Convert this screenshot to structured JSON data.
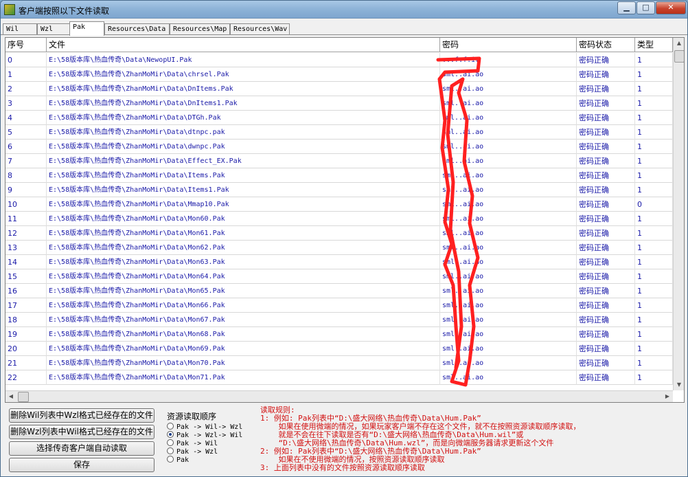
{
  "window": {
    "title": "客户端按照以下文件读取",
    "buttons": {
      "minimize": "▁",
      "maximize": "□",
      "close": "✕"
    }
  },
  "tabs": [
    {
      "label": "Wil",
      "active": false
    },
    {
      "label": "Wzl",
      "active": false
    },
    {
      "label": "Pak",
      "active": true
    },
    {
      "label": "Resources\\Data",
      "active": false
    },
    {
      "label": "Resources\\Map",
      "active": false
    },
    {
      "label": "Resources\\Wav",
      "active": false
    }
  ],
  "table": {
    "columns": [
      "序号",
      "文件",
      "密码",
      "密码状态",
      "类型"
    ],
    "rows": [
      {
        "idx": "0",
        "file": "E:\\58版本库\\热血传奇\\Data\\NewopUI.Pak",
        "pw": "...f.f.iv",
        "status": "密码正确",
        "type": "1"
      },
      {
        "idx": "1",
        "file": "E:\\58版本库\\热血传奇\\ZhanMoMir\\Data\\chrsel.Pak",
        "pw": "sml..ai.ao",
        "status": "密码正确",
        "type": "1"
      },
      {
        "idx": "2",
        "file": "E:\\58版本库\\热血传奇\\ZhanMoMir\\Data\\DnItems.Pak",
        "pw": "sml..ai.ao",
        "status": "密码正确",
        "type": "1"
      },
      {
        "idx": "3",
        "file": "E:\\58版本库\\热血传奇\\ZhanMoMir\\Data\\DnItems1.Pak",
        "pw": "sml..ai.ao",
        "status": "密码正确",
        "type": "1"
      },
      {
        "idx": "4",
        "file": "E:\\58版本库\\热血传奇\\ZhanMoMir\\Data\\DTGh.Pak",
        "pw": "sml..ai.ao",
        "status": "密码正确",
        "type": "1"
      },
      {
        "idx": "5",
        "file": "E:\\58版本库\\热血传奇\\ZhanMoMir\\Data\\dtnpc.pak",
        "pw": "sml..ai.ao",
        "status": "密码正确",
        "type": "1"
      },
      {
        "idx": "6",
        "file": "E:\\58版本库\\热血传奇\\ZhanMoMir\\Data\\dwnpc.Pak",
        "pw": "sml..ai.ao",
        "status": "密码正确",
        "type": "1"
      },
      {
        "idx": "7",
        "file": "E:\\58版本库\\热血传奇\\ZhanMoMir\\Data\\Effect_EX.Pak",
        "pw": "sml..ai.ao",
        "status": "密码正确",
        "type": "1"
      },
      {
        "idx": "8",
        "file": "E:\\58版本库\\热血传奇\\ZhanMoMir\\Data\\Items.Pak",
        "pw": "sml..ai.ao",
        "status": "密码正确",
        "type": "1"
      },
      {
        "idx": "9",
        "file": "E:\\58版本库\\热血传奇\\ZhanMoMir\\Data\\Items1.Pak",
        "pw": "sml..ai.ao",
        "status": "密码正确",
        "type": "1"
      },
      {
        "idx": "10",
        "file": "E:\\58版本库\\热血传奇\\ZhanMoMir\\Data\\Mmap10.Pak",
        "pw": "sml..ai.ao",
        "status": "密码正确",
        "type": "0"
      },
      {
        "idx": "11",
        "file": "E:\\58版本库\\热血传奇\\ZhanMoMir\\Data\\Mon60.Pak",
        "pw": "sml..ai.ao",
        "status": "密码正确",
        "type": "1"
      },
      {
        "idx": "12",
        "file": "E:\\58版本库\\热血传奇\\ZhanMoMir\\Data\\Mon61.Pak",
        "pw": "sml..ai.ao",
        "status": "密码正确",
        "type": "1"
      },
      {
        "idx": "13",
        "file": "E:\\58版本库\\热血传奇\\ZhanMoMir\\Data\\Mon62.Pak",
        "pw": "sml..ai.ao",
        "status": "密码正确",
        "type": "1"
      },
      {
        "idx": "14",
        "file": "E:\\58版本库\\热血传奇\\ZhanMoMir\\Data\\Mon63.Pak",
        "pw": "sml..ai.ao",
        "status": "密码正确",
        "type": "1"
      },
      {
        "idx": "15",
        "file": "E:\\58版本库\\热血传奇\\ZhanMoMir\\Data\\Mon64.Pak",
        "pw": "sml..ai.ao",
        "status": "密码正确",
        "type": "1"
      },
      {
        "idx": "16",
        "file": "E:\\58版本库\\热血传奇\\ZhanMoMir\\Data\\Mon65.Pak",
        "pw": "sml..ai.ao",
        "status": "密码正确",
        "type": "1"
      },
      {
        "idx": "17",
        "file": "E:\\58版本库\\热血传奇\\ZhanMoMir\\Data\\Mon66.Pak",
        "pw": "sml..ai.ao",
        "status": "密码正确",
        "type": "1"
      },
      {
        "idx": "18",
        "file": "E:\\58版本库\\热血传奇\\ZhanMoMir\\Data\\Mon67.Pak",
        "pw": "sml..ai.ao",
        "status": "密码正确",
        "type": "1"
      },
      {
        "idx": "19",
        "file": "E:\\58版本库\\热血传奇\\ZhanMoMir\\Data\\Mon68.Pak",
        "pw": "sml..ai.ao",
        "status": "密码正确",
        "type": "1"
      },
      {
        "idx": "20",
        "file": "E:\\58版本库\\热血传奇\\ZhanMoMir\\Data\\Mon69.Pak",
        "pw": "sml..ai.ao",
        "status": "密码正确",
        "type": "1"
      },
      {
        "idx": "21",
        "file": "E:\\58版本库\\热血传奇\\ZhanMoMir\\Data\\Mon70.Pak",
        "pw": "sml..ai.ao",
        "status": "密码正确",
        "type": "1"
      },
      {
        "idx": "22",
        "file": "E:\\58版本库\\热血传奇\\ZhanMoMir\\Data\\Mon71.Pak",
        "pw": "sml..ai.ao",
        "status": "密码正确",
        "type": "1"
      }
    ]
  },
  "buttons": [
    {
      "label": "删除Wil列表中Wzl格式已经存在的文件"
    },
    {
      "label": "删除Wzl列表中Wil格式已经存在的文件"
    },
    {
      "label": "选择传奇客户端自动读取"
    },
    {
      "label": "保存"
    }
  ],
  "resource_order": {
    "label": "资源读取顺序",
    "options": [
      {
        "label": "Pak -> Wil-> Wzl",
        "selected": false
      },
      {
        "label": "Pak -> Wzl-> Wil",
        "selected": true
      },
      {
        "label": "Pak -> Wil",
        "selected": false
      },
      {
        "label": "Pak -> Wzl",
        "selected": false
      },
      {
        "label": "Pak",
        "selected": false
      }
    ]
  },
  "rules": [
    "读取规则:",
    "1: 例如: Pak列表中“D:\\盛大网络\\热血传奇\\Data\\Hum.Pak”",
    "    如果在使用微端的情况，如果玩家客户端不存在这个文件，就不在按照资源读取顺序读取，",
    "    就是不会在往下读取是否有“D:\\盛大网络\\热血传奇\\Data\\Hum.wil”或",
    "    “D:\\盛大网络\\热血传奇\\Data\\Hum.wzl”，而是向微端服务器请求更新这个文件",
    "2: 例如: Pak列表中“D:\\盛大网络\\热血传奇\\Data\\Hum.Pak”",
    "    如果在不使用微端的情况，按照资源读取顺序读取",
    "3: 上面列表中没有的文件按照资源读取顺序读取"
  ],
  "colors": {
    "link_text": "#1a1aa8",
    "rules_text": "#d21010",
    "redaction": "#ff2020"
  }
}
